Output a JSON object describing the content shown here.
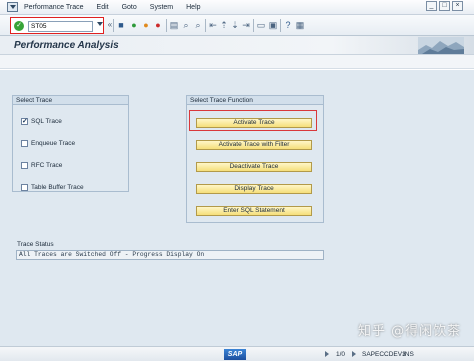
{
  "menubar": {
    "items": [
      "Performance Trace",
      "Edit",
      "Goto",
      "System",
      "Help"
    ]
  },
  "toolbar": {
    "command_value": "ST05",
    "icons": [
      "save-icon",
      "back-icon",
      "exit-icon",
      "cancel-icon",
      "print-icon",
      "find-icon",
      "find-next-icon",
      "first-page-icon",
      "prev-page-icon",
      "next-page-icon",
      "last-page-icon",
      "new-session-icon",
      "shortcut-icon",
      "help-icon",
      "layout-icon"
    ]
  },
  "page": {
    "title": "Performance Analysis"
  },
  "select_trace": {
    "heading": "Select Trace",
    "options": [
      {
        "label": "SQL Trace",
        "checked": true
      },
      {
        "label": "Enqueue Trace",
        "checked": false
      },
      {
        "label": "RFC Trace",
        "checked": false
      },
      {
        "label": "Table Buffer Trace",
        "checked": false
      }
    ]
  },
  "trace_function": {
    "heading": "Select Trace Function",
    "buttons": [
      "Activate Trace",
      "Activate Trace with Filter",
      "Deactivate Trace",
      "Display Trace",
      "Enter SQL Statement"
    ]
  },
  "trace_status": {
    "label": "Trace Status",
    "value": "All Traces are Switched Off - Progress Display On"
  },
  "statusbar": {
    "logo": "SAP",
    "page": "1/0",
    "system": "SAPECCDEV3",
    "mode": "INS"
  },
  "watermark": "知乎 @得闲饮茶"
}
